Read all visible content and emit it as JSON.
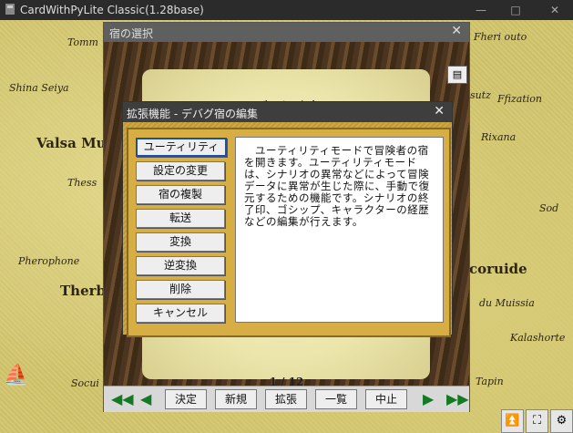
{
  "app": {
    "title": "CardWithPyLite Classic(1.28base)",
    "controls": [
      "—",
      "□",
      "✕"
    ]
  },
  "map": {
    "labels": [
      {
        "text": "Tomm",
        "big": false
      },
      {
        "text": "Shina Seiya",
        "big": false
      },
      {
        "text": "Valsa Mu",
        "big": true
      },
      {
        "text": "Thess",
        "big": false
      },
      {
        "text": "Pherophone",
        "big": false
      },
      {
        "text": "Therb",
        "big": true
      },
      {
        "text": "Socui",
        "big": false
      },
      {
        "text": "Fheri outo",
        "big": false
      },
      {
        "text": "sutz",
        "big": false
      },
      {
        "text": "Ffization",
        "big": false
      },
      {
        "text": "Rixana",
        "big": false
      },
      {
        "text": "Sod",
        "big": false
      },
      {
        "text": "Icoruide",
        "big": true
      },
      {
        "text": "du Muissia",
        "big": false
      },
      {
        "text": "Kalashorte",
        "big": false
      },
      {
        "text": "Tapin",
        "big": false
      }
    ]
  },
  "inn_window": {
    "title": "宿の選択",
    "heading": "デバグ宿",
    "page": "1 / 12",
    "toolbar": {
      "first_icon": "double-left-arrow",
      "prev_icon": "left-arrow",
      "next_icon": "right-arrow",
      "last_icon": "double-right-arrow",
      "buttons": [
        "決定",
        "新規",
        "拡張",
        "一覧",
        "中止"
      ]
    }
  },
  "ext_dialog": {
    "title": "拡張機能 - デバグ宿の編集",
    "buttons": [
      "ユーティリティ",
      "設定の変更",
      "宿の複製",
      "転送",
      "変換",
      "逆変換",
      "削除",
      "キャンセル"
    ],
    "selected_index": 0,
    "description": "　ユーティリティモードで冒険者の宿を開きます。ユーティリティモードは、シナリオの異常などによって冒険データに異常が生じた際に、手動で復元するための機能です。シナリオの終了印、ゴシップ、キャラクターの経歴などの編集が行えます。"
  },
  "bottom_icons": [
    "double-up-icon",
    "fullscreen-icon",
    "gear-icon"
  ]
}
